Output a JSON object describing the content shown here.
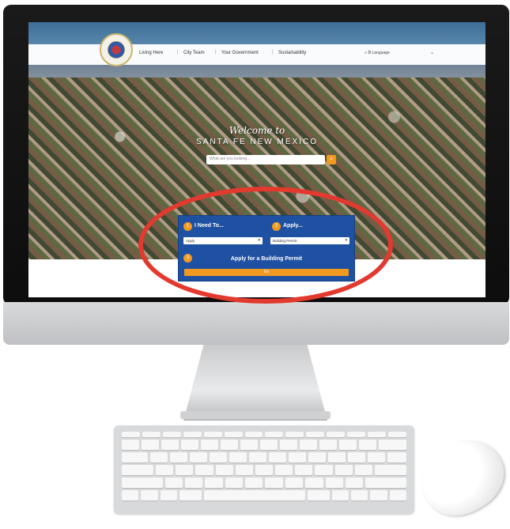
{
  "nav": {
    "items": [
      "Living Here",
      "City Team",
      "Your Government",
      "Sustainability"
    ],
    "language_label": "Language",
    "language_caret": "⌄"
  },
  "hero": {
    "welcome_line1": "Welcome to",
    "welcome_line2": "SANTA FE NEW MEXICO",
    "search_placeholder": "What are you looking...",
    "search_icon": "search-icon"
  },
  "widget": {
    "step1_number": "1",
    "step1_label": "I Need To...",
    "step1_value": "Apply",
    "step2_number": "2",
    "step2_label": "Apply...",
    "step2_value": "Building Permit",
    "step3_number": "3",
    "step3_title": "Apply for a Building Permit",
    "go_label": "Go",
    "accent_color": "#f19a1f",
    "panel_color": "#1f51a2"
  },
  "highlight_color": "#e23a2e"
}
